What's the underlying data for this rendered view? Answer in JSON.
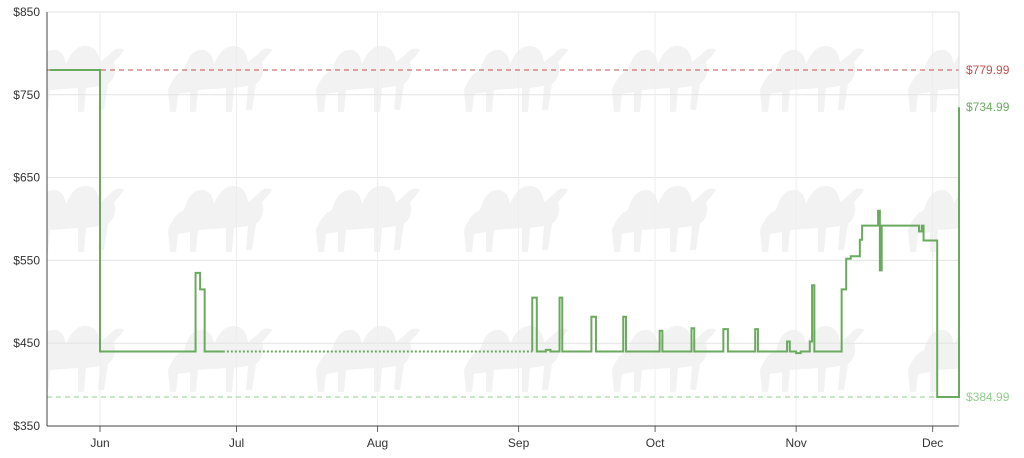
{
  "chart_data": {
    "type": "line",
    "title": "",
    "xlabel": "",
    "ylabel": "",
    "ylim": [
      350,
      850
    ],
    "y_ticks": [
      {
        "value": 350,
        "label": "$350"
      },
      {
        "value": 450,
        "label": "$450"
      },
      {
        "value": 550,
        "label": "$550"
      },
      {
        "value": 650,
        "label": "$650"
      },
      {
        "value": 750,
        "label": "$750"
      },
      {
        "value": 850,
        "label": "$850"
      }
    ],
    "xlim_days": [
      -10,
      179
    ],
    "x_ticks": [
      {
        "day": 1,
        "label": "Jun"
      },
      {
        "day": 31,
        "label": "Jul"
      },
      {
        "day": 62,
        "label": "Aug"
      },
      {
        "day": 93,
        "label": "Sep"
      },
      {
        "day": 123,
        "label": "Oct"
      },
      {
        "day": 154,
        "label": "Nov"
      },
      {
        "day": 184,
        "label": "Dec"
      }
    ],
    "grid": true,
    "reference_lines": [
      {
        "value": 779.99,
        "label": "$779.99",
        "color": "#c0504d",
        "style": "dashed"
      },
      {
        "value": 734.99,
        "label": "$734.99",
        "color": "#6aaa5e",
        "style": "none"
      },
      {
        "value": 384.99,
        "label": "$384.99",
        "color": "#8fd08a",
        "style": "dashed"
      }
    ],
    "series_color": "#6aaa5e",
    "series": [
      {
        "name": "",
        "points": [
          [
            -10,
            779.99
          ],
          [
            1,
            779.99
          ],
          [
            1,
            439.99
          ],
          [
            22,
            439.99
          ],
          [
            22,
            535
          ],
          [
            23,
            535
          ],
          [
            23,
            515
          ],
          [
            24,
            515
          ],
          [
            24,
            439.99
          ],
          [
            28,
            439.99
          ],
          [
            28,
            439.99,
            "gap"
          ],
          [
            96,
            439.99
          ],
          [
            96,
            505
          ],
          [
            97,
            505
          ],
          [
            97,
            439.99
          ],
          [
            99,
            439.99
          ],
          [
            99,
            442
          ],
          [
            100,
            442
          ],
          [
            100,
            439.99
          ],
          [
            102,
            439.99
          ],
          [
            102,
            505
          ],
          [
            102.6,
            505
          ],
          [
            102.6,
            439.99
          ],
          [
            109,
            439.99
          ],
          [
            109,
            482
          ],
          [
            110,
            482
          ],
          [
            110,
            439.99
          ],
          [
            116,
            439.99
          ],
          [
            116,
            482
          ],
          [
            116.6,
            482
          ],
          [
            116.6,
            439.99
          ],
          [
            124,
            439.99
          ],
          [
            124,
            465
          ],
          [
            124.6,
            465
          ],
          [
            124.6,
            439.99
          ],
          [
            131,
            439.99
          ],
          [
            131,
            468
          ],
          [
            131.6,
            468
          ],
          [
            131.6,
            439.99
          ],
          [
            138,
            439.99
          ],
          [
            138,
            467
          ],
          [
            139,
            467
          ],
          [
            139,
            439.99
          ],
          [
            145,
            439.99
          ],
          [
            145,
            467
          ],
          [
            145.6,
            467
          ],
          [
            145.6,
            439.99
          ],
          [
            152,
            439.99
          ],
          [
            152,
            452
          ],
          [
            152.6,
            452
          ],
          [
            152.6,
            439.99
          ],
          [
            154,
            439.99
          ],
          [
            154,
            438
          ],
          [
            155,
            438
          ],
          [
            155,
            439.99
          ],
          [
            157,
            439.99
          ],
          [
            157,
            452
          ],
          [
            157.5,
            452
          ],
          [
            157.5,
            520
          ],
          [
            158,
            520
          ],
          [
            158,
            439.99
          ],
          [
            164,
            439.99
          ],
          [
            164,
            515
          ],
          [
            165,
            515
          ],
          [
            165,
            552
          ],
          [
            166,
            552
          ],
          [
            166,
            555
          ],
          [
            168,
            555
          ],
          [
            168,
            575
          ],
          [
            168.5,
            575
          ],
          [
            168.5,
            592
          ],
          [
            172,
            592
          ],
          [
            172,
            610
          ],
          [
            172.4,
            610
          ],
          [
            172.4,
            538
          ],
          [
            172.8,
            538
          ],
          [
            172.8,
            592
          ],
          [
            181,
            592
          ],
          [
            181,
            585
          ],
          [
            181.6,
            585
          ],
          [
            181.6,
            592
          ],
          [
            182,
            592
          ],
          [
            182,
            574
          ],
          [
            184,
            574
          ],
          [
            184,
            574
          ],
          [
            185,
            574
          ],
          [
            185,
            384.99
          ],
          [
            201,
            384.99
          ],
          [
            201,
            515
          ],
          [
            201.5,
            515
          ],
          [
            201.5,
            585
          ],
          [
            201.8,
            585
          ],
          [
            201.8,
            625
          ],
          [
            202.2,
            625
          ],
          [
            202.2,
            600
          ],
          [
            202.5,
            600
          ],
          [
            202.5,
            655
          ],
          [
            202.8,
            655
          ],
          [
            202.8,
            728
          ],
          [
            203.2,
            728
          ],
          [
            203.2,
            730
          ],
          [
            203.6,
            730
          ],
          [
            203.6,
            555
          ],
          [
            204,
            555
          ],
          [
            204,
            734.99
          ],
          [
            205,
            734.99
          ]
        ]
      }
    ]
  }
}
